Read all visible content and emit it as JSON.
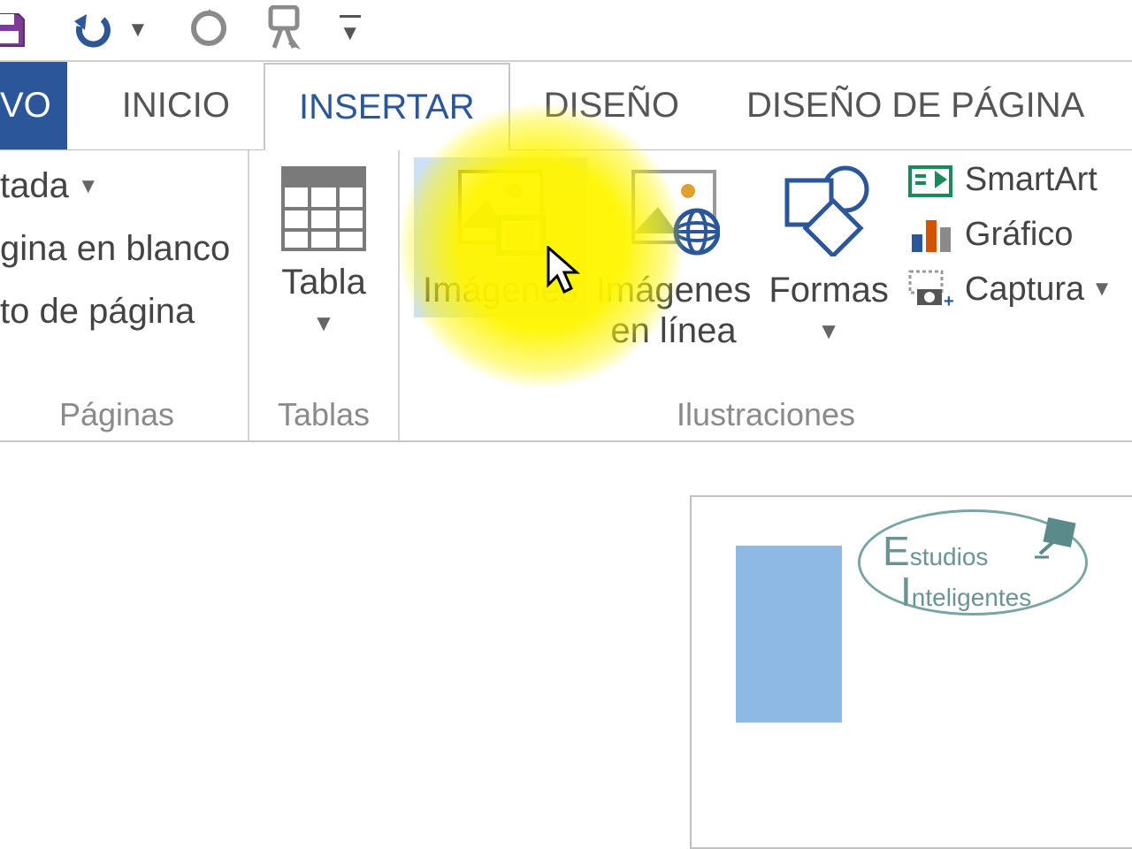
{
  "qat": {
    "icons": {
      "save": "save-icon",
      "undo": "undo-icon",
      "redo": "redo-icon",
      "touch": "touch-mode-icon",
      "more": "customize-qat-icon"
    }
  },
  "tabs": {
    "file": "VO",
    "inicio": "INICIO",
    "insertar": "INSERTAR",
    "diseno": "DISEÑO",
    "diseno_pagina": "DISEÑO DE PÁGINA"
  },
  "pages_group": {
    "portada": "tada",
    "pagina_blanco": "gina en blanco",
    "salto_pagina": "to de página",
    "label": "Páginas"
  },
  "tablas_group": {
    "tabla": "Tabla",
    "label": "Tablas"
  },
  "illus_group": {
    "imagenes": "Imágenes",
    "imagenes_linea": "Imágenes\nen línea",
    "formas": "Formas",
    "smartart": "SmartArt",
    "grafico": "Gráfico",
    "captura": "Captura",
    "label": "Ilustraciones"
  },
  "watermark": {
    "line1_big": "E",
    "line1_rest": "studios",
    "line2_big": "I",
    "line2_rest": "nteligentes"
  },
  "colors": {
    "accent": "#2b579a",
    "highlight": "#fff500"
  }
}
